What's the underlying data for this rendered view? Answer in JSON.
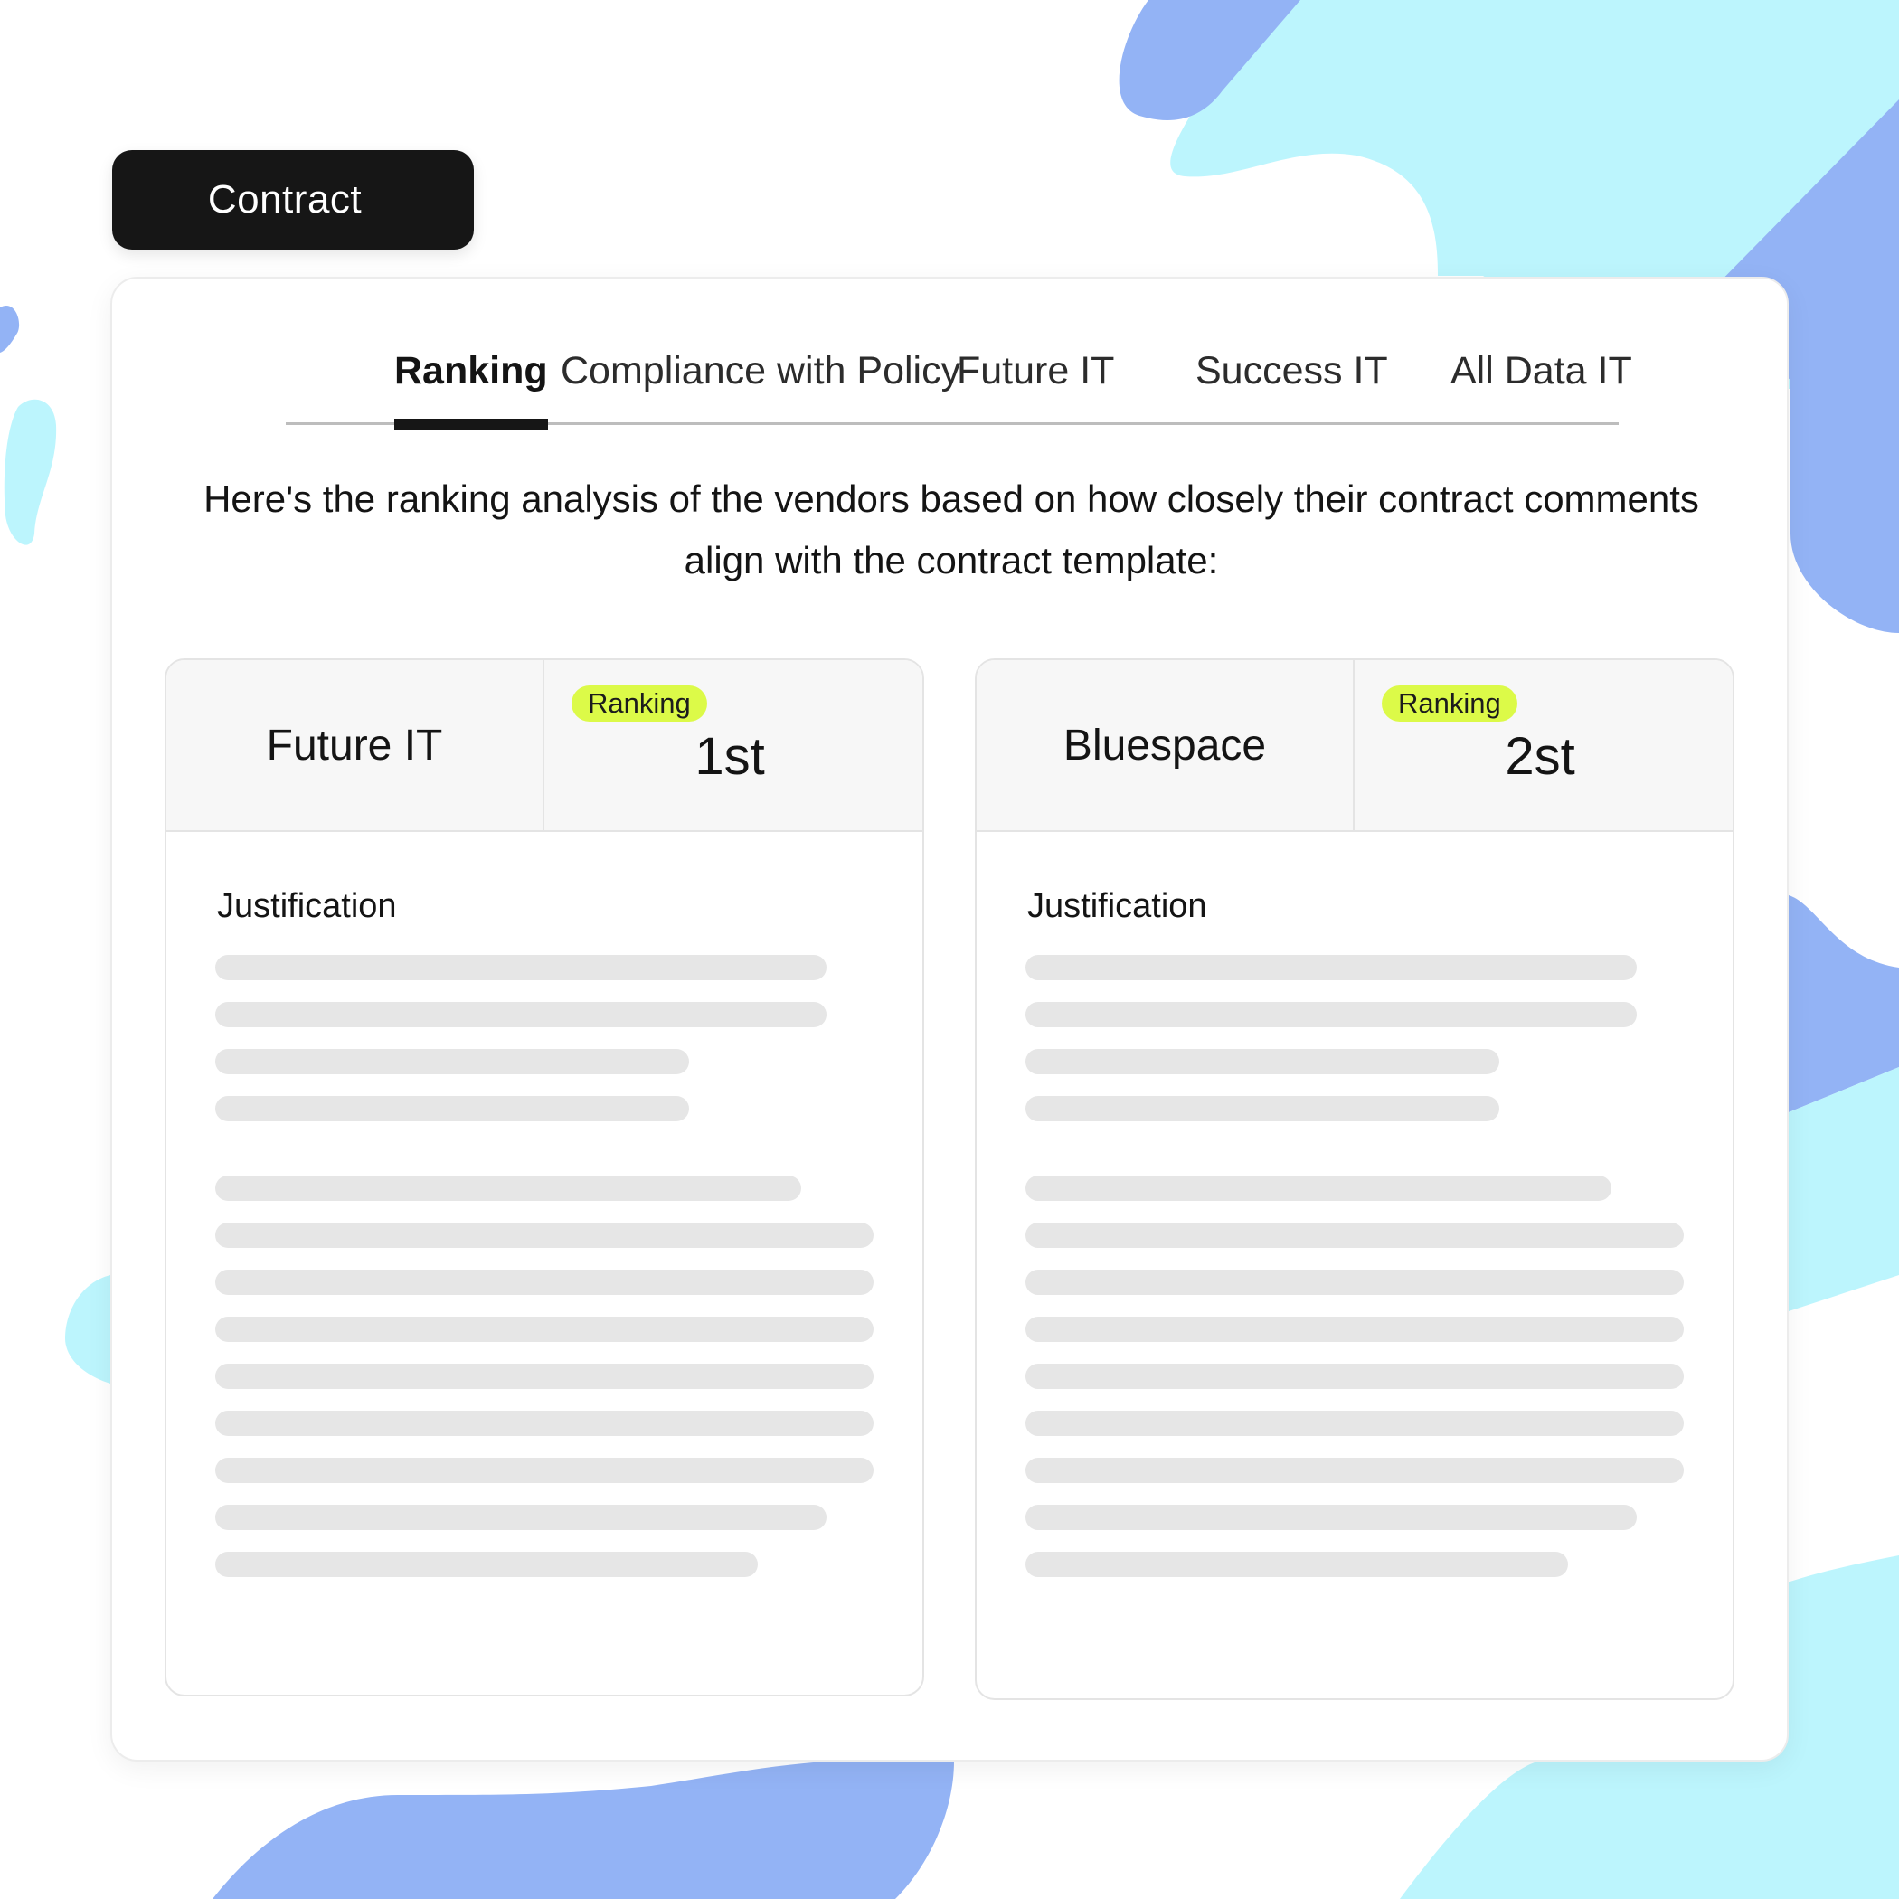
{
  "header": {
    "contract_label": "Contract"
  },
  "tabs": [
    {
      "label": "Ranking",
      "active": true
    },
    {
      "label": "Compliance with Policy",
      "active": false
    },
    {
      "label": "Future IT",
      "active": false
    },
    {
      "label": "Success IT",
      "active": false
    },
    {
      "label": "All Data IT",
      "active": false
    }
  ],
  "intro": {
    "line1": "Here's the ranking analysis of the vendors based on how closely their contract comments",
    "line2": "align with the contract template:"
  },
  "vendors": [
    {
      "name": "Future IT",
      "badge": "Ranking",
      "rank": "1st",
      "justification_label": "Justification"
    },
    {
      "name": "Bluespace",
      "badge": "Ranking",
      "rank": "2st",
      "justification_label": "Justification"
    }
  ],
  "colors": {
    "accent_dark": "#161616",
    "badge_green": "#dcfa48",
    "blob_blue": "#93b3f5",
    "blob_cyan": "#bcf5fd",
    "skeleton_gray": "#e6e6e6"
  }
}
